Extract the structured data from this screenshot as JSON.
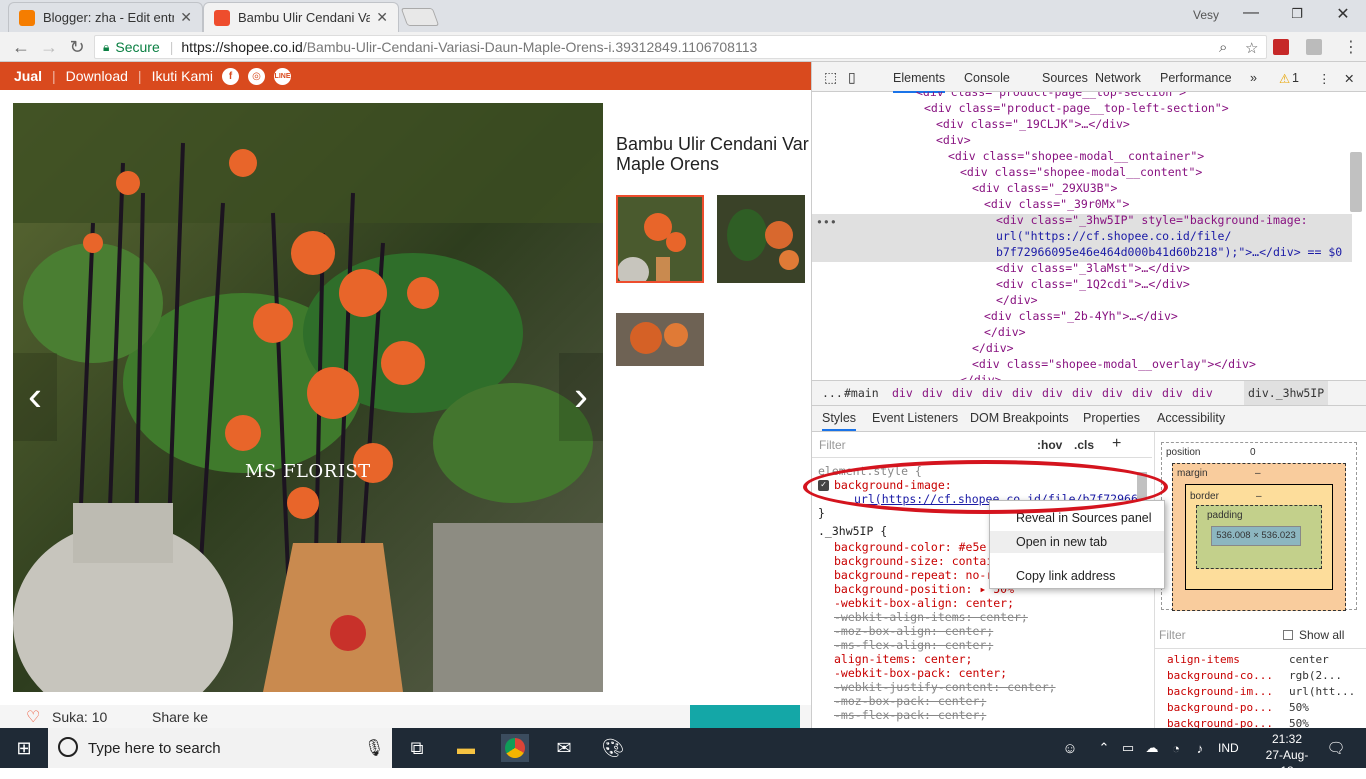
{
  "browser": {
    "tabs": [
      {
        "title": "Blogger: zha - Edit entri",
        "favicon_color": "#f57d00"
      },
      {
        "title": "Bambu Ulir Cendani Varia",
        "favicon_color": "#ee4d2d"
      }
    ],
    "profile_name": "Vesy",
    "window_controls": [
      "minimize-icon",
      "maximize-icon",
      "close-icon"
    ],
    "secure_label": "Secure",
    "url_host": "https://shopee.co.id",
    "url_path": "/Bambu-Ulir-Cendani-Variasi-Daun-Maple-Orens-i.39312849.1106708113"
  },
  "shopee": {
    "nav": [
      "Jual",
      "Download",
      "Ikuti Kami"
    ],
    "social": [
      "facebook-icon",
      "instagram-icon",
      "line-icon"
    ],
    "product_title_line1": "Bambu Ulir Cendani Var",
    "product_title_line2": "Maple Orens",
    "watermark": "MS FLORIST",
    "likes": "Suka: 10",
    "share": "Share ke"
  },
  "devtools": {
    "tabs": [
      "Elements",
      "Console",
      "Sources",
      "Network",
      "Performance",
      "»"
    ],
    "warning_count": "1",
    "dom": [
      "<div class=\"product-page__top-section\">",
      "<div class=\"product-page__top-left-section\">",
      "<div class=\"_19CLJK\">…</div>",
      "<div>",
      "<div class=\"shopee-modal__container\">",
      "<div class=\"shopee-modal__content\">",
      "<div class=\"_29XU3B\">",
      "<div class=\"_39r0Mx\">",
      "<div class=\"_3hw5IP\" style=\"background-image:",
      "url(\"https://cf.shopee.co.id/file/",
      "b7f72966095e46e464d000b41d60b218\");\">…</div> == $0",
      "<div class=\"_3laMst\">…</div>",
      "<div class=\"_1Q2cdi\">…</div>",
      "</div>",
      "<div class=\"_2b-4Yh\">…</div>",
      "</div>",
      "</div>",
      "<div class=\"shopee-modal__overlay\"></div>",
      "</div>"
    ],
    "breadcrumb": [
      "...",
      "#main",
      "div",
      "div",
      "div",
      "div",
      "div",
      "div",
      "div",
      "div",
      "div",
      "div",
      "div",
      "div._3hw5IP"
    ],
    "subtabs": [
      "Styles",
      "Event Listeners",
      "DOM Breakpoints",
      "Properties",
      "Accessibility"
    ],
    "filter_placeholder": "Filter",
    "hov": ":hov",
    "cls": ".cls",
    "styles": [
      {
        "text": "element.style {",
        "type": "sel"
      },
      {
        "text": "background-image:",
        "type": "prop"
      },
      {
        "text": "url(https://cf.shopee.co.id/file/b7f72966",
        "type": "url"
      },
      {
        "text": "}",
        "type": "sel"
      },
      {
        "text": "._3hw5IP {",
        "type": "sel"
      },
      {
        "text": "background-color: #e5e",
        "type": "prop"
      },
      {
        "text": "background-size: contain",
        "type": "prop"
      },
      {
        "text": "background-repeat: no-r",
        "type": "prop"
      },
      {
        "text": "background-position: ▸ 50%",
        "type": "prop"
      },
      {
        "text": "-webkit-box-align: center;",
        "type": "prop"
      },
      {
        "text": "-webkit-align-items: center;",
        "type": "strike"
      },
      {
        "text": "-moz-box-align: center;",
        "type": "strike"
      },
      {
        "text": "-ms-flex-align: center;",
        "type": "strike"
      },
      {
        "text": "align-items: center;",
        "type": "prop"
      },
      {
        "text": "-webkit-box-pack: center;",
        "type": "prop"
      },
      {
        "text": "-webkit-justify-content: center;",
        "type": "strike"
      },
      {
        "text": "-moz-box-pack: center;",
        "type": "strike"
      },
      {
        "text": "-ms-flex-pack: center;",
        "type": "strike"
      }
    ],
    "context_menu": [
      "Reveal in Sources panel",
      "Open in new tab",
      "Copy link address"
    ],
    "box_model": {
      "position_label": "position",
      "position_value": "0",
      "margin_label": "margin",
      "border_label": "border",
      "padding_label": "padding",
      "dash": "–",
      "content": "536.008 × 536.023"
    },
    "computed_filter": "Filter",
    "show_all": "Show all",
    "computed": [
      {
        "prop": "align-items",
        "value": "center"
      },
      {
        "prop": "background-co...",
        "value": "rgb(2..."
      },
      {
        "prop": "background-im...",
        "value": "url(htt..."
      },
      {
        "prop": "background-po...",
        "value": "50%"
      },
      {
        "prop": "background-po...",
        "value": "50%"
      }
    ]
  },
  "taskbar": {
    "search_placeholder": "Type here to search",
    "lang": "IND",
    "time": "21:32",
    "date": "27-Aug-18"
  }
}
